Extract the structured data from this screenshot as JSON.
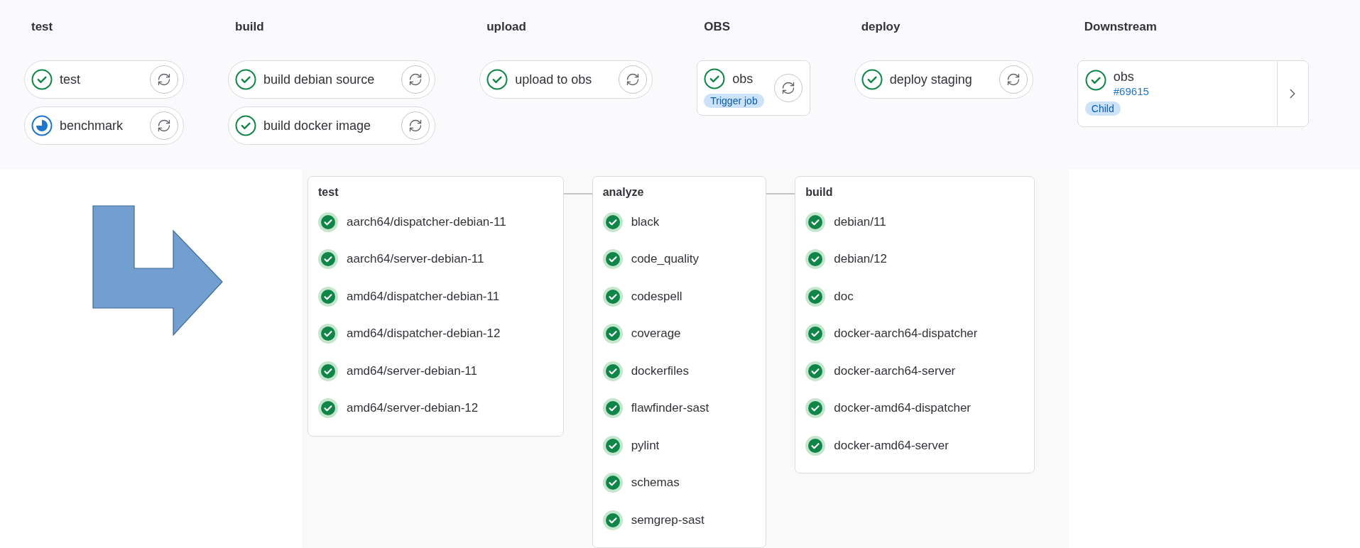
{
  "pipeline": {
    "stages": [
      {
        "title": "test",
        "jobs": [
          {
            "kind": "job",
            "name": "test",
            "running": false
          },
          {
            "kind": "job",
            "name": "benchmark",
            "running": true
          }
        ]
      },
      {
        "title": "build",
        "jobs": [
          {
            "kind": "job",
            "name": "build debian source",
            "running": false
          },
          {
            "kind": "job",
            "name": "build docker image",
            "running": false
          }
        ]
      },
      {
        "title": "upload",
        "jobs": [
          {
            "kind": "job",
            "name": "upload to obs",
            "running": false
          }
        ]
      },
      {
        "title": "OBS",
        "jobs": [
          {
            "kind": "trigger",
            "name": "obs",
            "running": false,
            "badge": "Trigger job"
          }
        ]
      },
      {
        "title": "deploy",
        "jobs": [
          {
            "kind": "job",
            "name": "deploy staging",
            "running": false
          }
        ]
      },
      {
        "title": "Downstream",
        "jobs": [
          {
            "kind": "downstream",
            "name": "obs",
            "running": false,
            "link": "#69615",
            "badge": "Child"
          }
        ]
      }
    ]
  },
  "child_pipeline": {
    "stages": [
      {
        "title": "test",
        "jobs": [
          {
            "name": "aarch64/dispatcher-debian-11",
            "running": false
          },
          {
            "name": "aarch64/server-debian-11",
            "running": false
          },
          {
            "name": "amd64/dispatcher-debian-11",
            "running": false
          },
          {
            "name": "amd64/dispatcher-debian-12",
            "running": false
          },
          {
            "name": "amd64/server-debian-11",
            "running": false
          },
          {
            "name": "amd64/server-debian-12",
            "running": false
          }
        ]
      },
      {
        "title": "analyze",
        "jobs": [
          {
            "name": "black",
            "running": false
          },
          {
            "name": "code_quality",
            "running": false
          },
          {
            "name": "codespell",
            "running": false
          },
          {
            "name": "coverage",
            "running": false
          },
          {
            "name": "dockerfiles",
            "running": false
          },
          {
            "name": "flawfinder-sast",
            "running": false
          },
          {
            "name": "pylint",
            "running": false
          },
          {
            "name": "schemas",
            "running": false
          },
          {
            "name": "semgrep-sast",
            "running": false
          }
        ]
      },
      {
        "title": "build",
        "jobs": [
          {
            "name": "debian/11",
            "running": false
          },
          {
            "name": "debian/12",
            "running": false
          },
          {
            "name": "doc",
            "running": false
          },
          {
            "name": "docker-aarch64-dispatcher",
            "running": false
          },
          {
            "name": "docker-aarch64-server",
            "running": false
          },
          {
            "name": "docker-amd64-dispatcher",
            "running": false
          },
          {
            "name": "docker-amd64-server",
            "running": false
          }
        ]
      }
    ]
  }
}
